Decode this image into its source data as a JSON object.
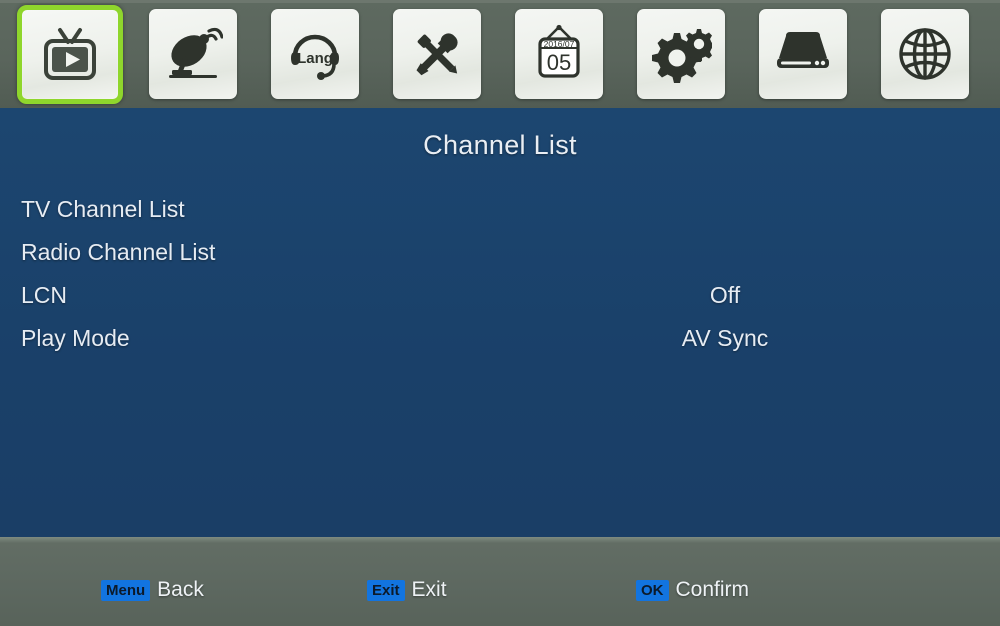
{
  "colors": {
    "panel_bg": "#1a4069",
    "bar_bg": "#5d6860",
    "selection": "#8fd62c",
    "key_badge": "#1274e0",
    "text": "#e6ecf3"
  },
  "topbar": {
    "items": [
      {
        "id": "channel",
        "icon": "tv-icon",
        "label": "Channel",
        "selected": true
      },
      {
        "id": "install",
        "icon": "satellite-dish-icon",
        "label": "Installation",
        "selected": false
      },
      {
        "id": "language",
        "icon": "headset-lang-icon",
        "label": "Language",
        "selected": false,
        "icon_text": "Lang"
      },
      {
        "id": "system",
        "icon": "tools-icon",
        "label": "System Setup",
        "selected": false
      },
      {
        "id": "time",
        "icon": "calendar-icon",
        "label": "Time",
        "selected": false,
        "icon_text_top": "2016/07",
        "icon_text_bottom": "05"
      },
      {
        "id": "settings",
        "icon": "gears-icon",
        "label": "Settings",
        "selected": false
      },
      {
        "id": "usb",
        "icon": "hard-drive-icon",
        "label": "USB",
        "selected": false
      },
      {
        "id": "network",
        "icon": "globe-icon",
        "label": "Network",
        "selected": false
      }
    ]
  },
  "main": {
    "title": "Channel List",
    "rows": [
      {
        "label": "TV Channel List",
        "value": ""
      },
      {
        "label": "Radio Channel List",
        "value": ""
      },
      {
        "label": "LCN",
        "value": "Off"
      },
      {
        "label": "Play Mode",
        "value": "AV Sync"
      }
    ]
  },
  "bottombar": {
    "hints": [
      {
        "key": "Menu",
        "action": "Back"
      },
      {
        "key": "Exit",
        "action": "Exit"
      },
      {
        "key": "OK",
        "action": "Confirm"
      }
    ]
  }
}
